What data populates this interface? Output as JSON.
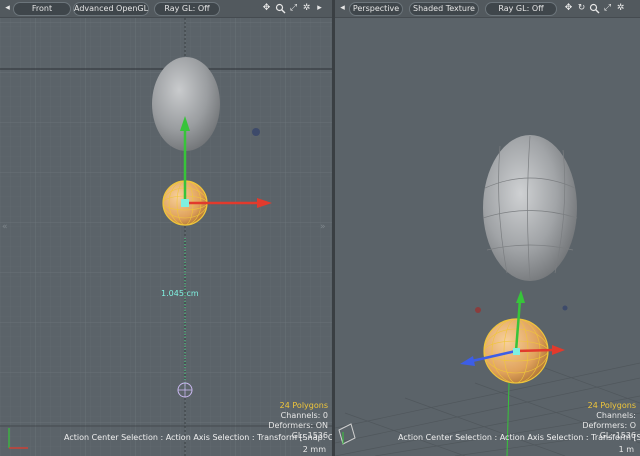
{
  "left_viewport": {
    "view_label": "Front",
    "shading_label": "Advanced OpenGL",
    "raygl_label": "Ray GL: Off",
    "measure_label": "1.045 cm",
    "hud": {
      "polygons": "24 Polygons",
      "channels": "Channels: 0",
      "deformers": "Deformers: ON",
      "gl": "GL: 1536"
    },
    "scale": "2 mm"
  },
  "right_viewport": {
    "view_label": "Perspective",
    "shading_label": "Shaded Texture",
    "raygl_label": "Ray GL: Off",
    "hud": {
      "polygons": "24 Polygons",
      "channels": "Channels:",
      "deformers": "Deformers: O",
      "gl": "GL: 1536"
    },
    "scale": "1 m"
  },
  "status_bar": {
    "left_text": "Action Center Selection : Action Axis Selection : Transform  [Snap: Off]",
    "right_text": "Action Center Selection : Action Axis Selection : Transform  [Snap: Off]"
  },
  "icons": [
    "menu-arrow-icon",
    "pan-icon",
    "zoom-icon",
    "fit-icon",
    "gear-icon",
    "play-right-icon",
    "rotate-icon"
  ],
  "colors": {
    "x_axis": "#e23a2c",
    "y_axis": "#37c43a",
    "z_axis": "#3d5ee6",
    "selection": "#f0c63a",
    "sphere": "#e3a660",
    "viewport_bg": "#5b6369"
  }
}
